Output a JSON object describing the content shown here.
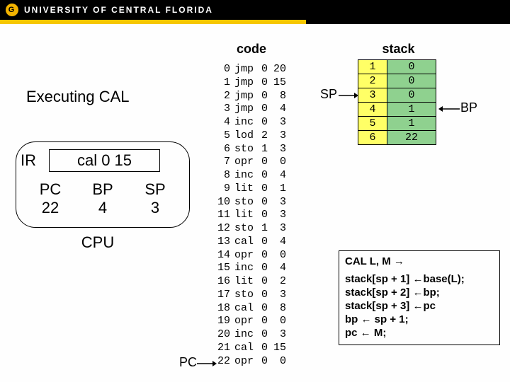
{
  "header": {
    "brand": "UNIVERSITY OF CENTRAL FLORIDA",
    "logo_letter": "G"
  },
  "titles": {
    "code": "code",
    "stack": "stack"
  },
  "executing": "Executing CAL",
  "cpu": {
    "ir_label": "IR",
    "ir_value": "cal 0 15",
    "regs": {
      "pc_label": "PC",
      "pc_val": "22",
      "bp_label": "BP",
      "bp_val": "4",
      "sp_label": "SP",
      "sp_val": "3"
    },
    "label": "CPU"
  },
  "pc_marker": "PC",
  "sp_marker": "SP",
  "bp_marker": "BP",
  "code": [
    {
      "a": "0",
      "op": "jmp",
      "l": "0",
      "m": "20"
    },
    {
      "a": "1",
      "op": "jmp",
      "l": "0",
      "m": "15"
    },
    {
      "a": "2",
      "op": "jmp",
      "l": "0",
      "m": "8"
    },
    {
      "a": "3",
      "op": "jmp",
      "l": "0",
      "m": "4"
    },
    {
      "a": "4",
      "op": "inc",
      "l": "0",
      "m": "3"
    },
    {
      "a": "5",
      "op": "lod",
      "l": "2",
      "m": "3"
    },
    {
      "a": "6",
      "op": "sto",
      "l": "1",
      "m": "3"
    },
    {
      "a": "7",
      "op": "opr",
      "l": "0",
      "m": "0"
    },
    {
      "a": "8",
      "op": "inc",
      "l": "0",
      "m": "4"
    },
    {
      "a": "9",
      "op": "lit",
      "l": "0",
      "m": "1"
    },
    {
      "a": "10",
      "op": "sto",
      "l": "0",
      "m": "3"
    },
    {
      "a": "11",
      "op": "lit",
      "l": "0",
      "m": "3"
    },
    {
      "a": "12",
      "op": "sto",
      "l": "1",
      "m": "3"
    },
    {
      "a": "13",
      "op": "cal",
      "l": "0",
      "m": "4"
    },
    {
      "a": "14",
      "op": "opr",
      "l": "0",
      "m": "0"
    },
    {
      "a": "15",
      "op": "inc",
      "l": "0",
      "m": "4"
    },
    {
      "a": "16",
      "op": "lit",
      "l": "0",
      "m": "2"
    },
    {
      "a": "17",
      "op": "sto",
      "l": "0",
      "m": "3"
    },
    {
      "a": "18",
      "op": "cal",
      "l": "0",
      "m": "8"
    },
    {
      "a": "19",
      "op": "opr",
      "l": "0",
      "m": "0"
    },
    {
      "a": "20",
      "op": "inc",
      "l": "0",
      "m": "3"
    },
    {
      "a": "21",
      "op": "cal",
      "l": "0",
      "m": "15"
    },
    {
      "a": "22",
      "op": "opr",
      "l": "0",
      "m": "0"
    }
  ],
  "stack": [
    {
      "i": "1",
      "v": "0"
    },
    {
      "i": "2",
      "v": "0"
    },
    {
      "i": "3",
      "v": "0"
    },
    {
      "i": "4",
      "v": "1"
    },
    {
      "i": "5",
      "v": "1"
    },
    {
      "i": "6",
      "v": "22"
    }
  ],
  "pseudo": {
    "title": "CAL   L, M →",
    "lines": [
      "stack[sp + 1] ←base(L);",
      "stack[sp + 2] ←bp;",
      "stack[sp + 3] ←pc",
      "bp ← sp + 1;",
      "pc ← M;"
    ]
  }
}
